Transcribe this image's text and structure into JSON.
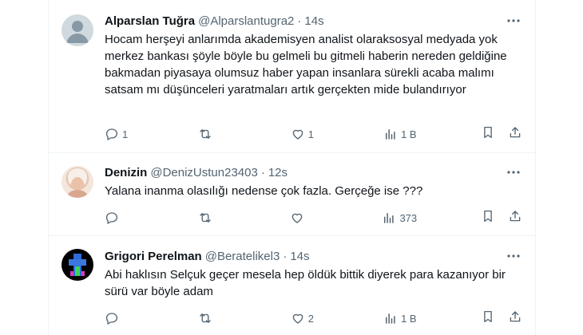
{
  "tweets": [
    {
      "name": "Alparslan Tuğra",
      "handle": "@Alparslantugra2",
      "time": "14s",
      "text": "Hocam herşeyi anlarımda akademisyen analist olaraksosyal medyada yok merkez bankası şöyle böyle bu gelmeli bu gitmeli haberin nereden geldiğine bakmadan piyasaya olumsuz haber yapan insanlara sürekli acaba malımı satsam mı düşünceleri yaratmaları artık gerçekten mide bulandırıyor",
      "replies": "1",
      "retweets": "",
      "likes": "1",
      "views": "1 B"
    },
    {
      "name": "Denizin",
      "handle": "@DenizUstun23403",
      "time": "12s",
      "text": "Yalana inanma olasılığı nedense çok fazla. Gerçeğe ise ???",
      "replies": "",
      "retweets": "",
      "likes": "",
      "views": "373"
    },
    {
      "name": "Grigori Perelman",
      "handle": "@Beratelikel3",
      "time": "14s",
      "text": "Abi haklısın Selçuk geçer mesela hep öldük bittik diyerek para kazanıyor bir sürü var böyle adam",
      "replies": "",
      "retweets": "",
      "likes": "2",
      "views": "1 B"
    }
  ],
  "icons": [
    "more-icon",
    "reply-icon",
    "retweet-icon",
    "like-icon",
    "views-icon",
    "bookmark-icon",
    "share-icon"
  ],
  "colors": {
    "text": "#0f1419",
    "secondary": "#536471",
    "border": "#eff3f4"
  }
}
